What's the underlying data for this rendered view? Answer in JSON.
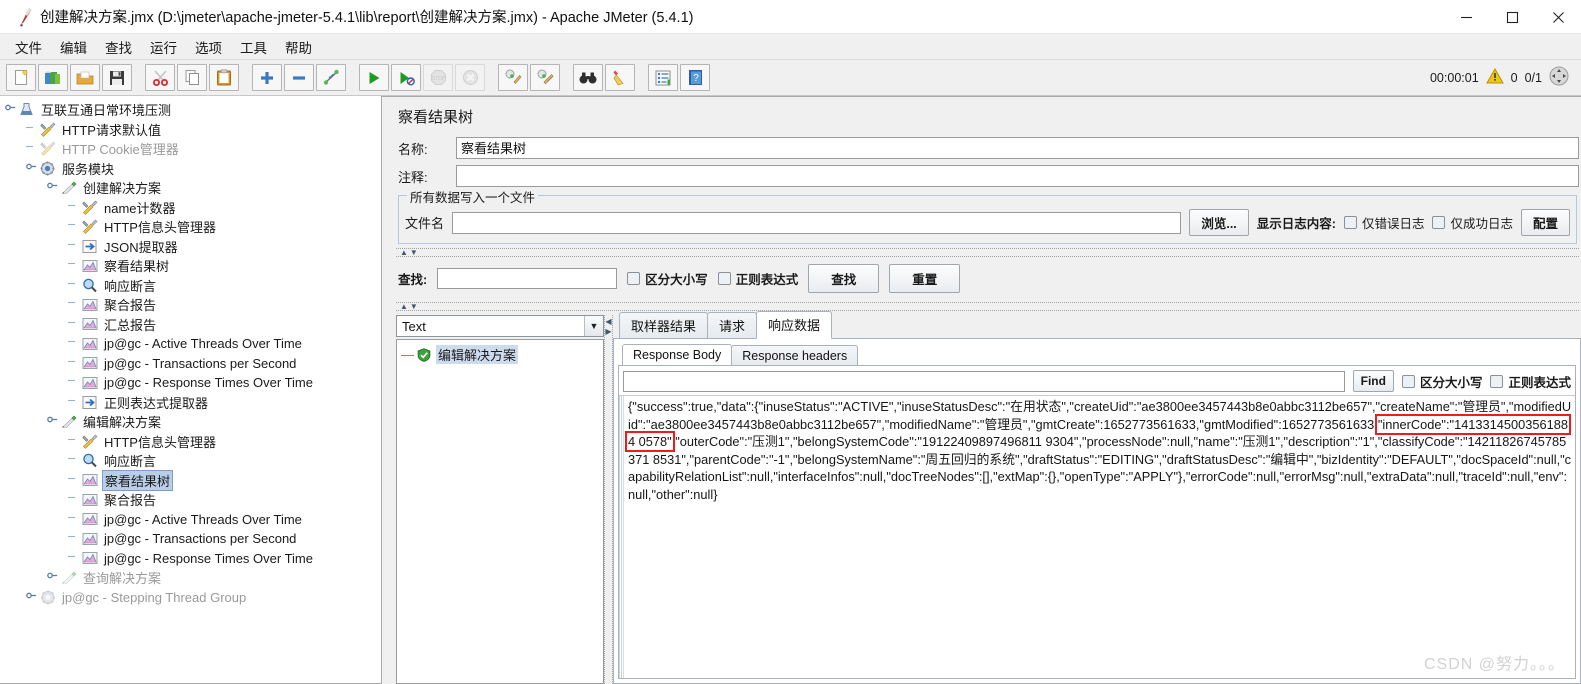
{
  "window": {
    "title": "创建解决方案.jmx (D:\\jmeter\\apache-jmeter-5.4.1\\lib\\report\\创建解决方案.jmx) - Apache JMeter (5.4.1)",
    "icon": "jmeter-feather-icon",
    "minimize": "—",
    "maximize": "☐",
    "close": "✕"
  },
  "menubar": {
    "items": [
      {
        "label": "文件",
        "name": "menu-file"
      },
      {
        "label": "编辑",
        "name": "menu-edit"
      },
      {
        "label": "查找",
        "name": "menu-search"
      },
      {
        "label": "运行",
        "name": "menu-run"
      },
      {
        "label": "选项",
        "name": "menu-options"
      },
      {
        "label": "工具",
        "name": "menu-tools"
      },
      {
        "label": "帮助",
        "name": "menu-help"
      }
    ]
  },
  "toolbar": {
    "buttons": [
      {
        "name": "new-button",
        "icon": "new-document-icon",
        "disabled": false
      },
      {
        "name": "templates-button",
        "icon": "templates-icon",
        "disabled": false
      },
      {
        "name": "open-button",
        "icon": "open-folder-icon",
        "disabled": false
      },
      {
        "name": "save-button",
        "icon": "floppy-save-icon",
        "disabled": false
      },
      {
        "sep": true
      },
      {
        "name": "cut-button",
        "icon": "scissors-icon",
        "disabled": false
      },
      {
        "name": "copy-button",
        "icon": "copy-icon",
        "disabled": false
      },
      {
        "name": "paste-button",
        "icon": "clipboard-paste-icon",
        "disabled": false
      },
      {
        "sep": true
      },
      {
        "name": "expand-all-button",
        "icon": "plus-icon",
        "disabled": false
      },
      {
        "name": "collapse-all-button",
        "icon": "minus-icon",
        "disabled": false
      },
      {
        "name": "toggle-button",
        "icon": "toggle-pins-icon",
        "disabled": false
      },
      {
        "sep": true
      },
      {
        "name": "start-button",
        "icon": "play-green-icon",
        "disabled": false
      },
      {
        "name": "start-no-pauses-button",
        "icon": "play-no-pause-icon",
        "disabled": false
      },
      {
        "name": "stop-button",
        "icon": "stop-sign-icon",
        "disabled": true
      },
      {
        "name": "shutdown-button",
        "icon": "shutdown-x-icon",
        "disabled": true
      },
      {
        "sep": true
      },
      {
        "name": "clear-button",
        "icon": "broom-clear-icon",
        "disabled": false
      },
      {
        "name": "clear-all-button",
        "icon": "broom-clear-all-icon",
        "disabled": false
      },
      {
        "sep": true
      },
      {
        "name": "search-button",
        "icon": "binoculars-icon",
        "disabled": false
      },
      {
        "name": "reset-search-button",
        "icon": "broom-yellow-icon",
        "disabled": false
      },
      {
        "sep": true
      },
      {
        "name": "function-helper-button",
        "icon": "list-toolbox-icon",
        "disabled": false
      },
      {
        "name": "help-button",
        "icon": "help-book-icon",
        "disabled": false
      }
    ],
    "status": {
      "elapsed": "00:00:01",
      "warning_icon": "warning-triangle-icon",
      "warning_count": "0",
      "threads": "0/1",
      "expand_icon": "expand-arrows-icon"
    }
  },
  "tree": {
    "nodes": [
      {
        "label": "互联互通日常环境压测",
        "depth": 0,
        "icon": "test-plan-icon",
        "handle": "expanded",
        "state": "normal",
        "name": "tree-node-test-plan"
      },
      {
        "label": "HTTP请求默认值",
        "depth": 1,
        "icon": "config-wrench-icon",
        "handle": "leaf",
        "state": "normal",
        "name": "tree-node-http-defaults"
      },
      {
        "label": "HTTP Cookie管理器",
        "depth": 1,
        "icon": "config-wrench-icon",
        "handle": "leaf",
        "state": "disabled",
        "name": "tree-node-http-cookie-manager"
      },
      {
        "label": "服务模块",
        "depth": 1,
        "icon": "controller-gear-icon",
        "handle": "expanded",
        "state": "normal",
        "name": "tree-node-service-module"
      },
      {
        "label": "创建解决方案",
        "depth": 2,
        "icon": "sampler-pen-icon",
        "handle": "expanded",
        "state": "normal",
        "name": "tree-node-create-solution"
      },
      {
        "label": "name计数器",
        "depth": 3,
        "icon": "config-wrench-icon",
        "handle": "leaf",
        "state": "normal",
        "name": "tree-node-name-counter"
      },
      {
        "label": "HTTP信息头管理器",
        "depth": 3,
        "icon": "config-wrench-icon",
        "handle": "leaf",
        "state": "normal",
        "name": "tree-node-http-header-manager-1"
      },
      {
        "label": "JSON提取器",
        "depth": 3,
        "icon": "postprocessor-arrow-icon",
        "handle": "leaf",
        "state": "normal",
        "name": "tree-node-json-extractor"
      },
      {
        "label": "察看结果树",
        "depth": 3,
        "icon": "listener-chart-icon",
        "handle": "leaf",
        "state": "normal",
        "name": "tree-node-view-results-tree-1"
      },
      {
        "label": "响应断言",
        "depth": 3,
        "icon": "assertion-magnifier-icon",
        "handle": "leaf",
        "state": "normal",
        "name": "tree-node-response-assertion-1"
      },
      {
        "label": "聚合报告",
        "depth": 3,
        "icon": "listener-chart-icon",
        "handle": "leaf",
        "state": "normal",
        "name": "tree-node-aggregate-report-1"
      },
      {
        "label": "汇总报告",
        "depth": 3,
        "icon": "listener-chart-icon",
        "handle": "leaf",
        "state": "normal",
        "name": "tree-node-summary-report"
      },
      {
        "label": "jp@gc - Active Threads Over Time",
        "depth": 3,
        "icon": "listener-chart-icon",
        "handle": "leaf",
        "state": "normal",
        "name": "tree-node-active-threads-1"
      },
      {
        "label": "jp@gc - Transactions per Second",
        "depth": 3,
        "icon": "listener-chart-icon",
        "handle": "leaf",
        "state": "normal",
        "name": "tree-node-tps-1"
      },
      {
        "label": "jp@gc - Response Times Over Time",
        "depth": 3,
        "icon": "listener-chart-icon",
        "handle": "leaf",
        "state": "normal",
        "name": "tree-node-response-times-1"
      },
      {
        "label": "正则表达式提取器",
        "depth": 3,
        "icon": "postprocessor-arrow-icon",
        "handle": "leaf",
        "state": "normal",
        "name": "tree-node-regex-extractor"
      },
      {
        "label": "编辑解决方案",
        "depth": 2,
        "icon": "sampler-pen-icon",
        "handle": "expanded",
        "state": "normal",
        "name": "tree-node-edit-solution"
      },
      {
        "label": "HTTP信息头管理器",
        "depth": 3,
        "icon": "config-wrench-icon",
        "handle": "leaf",
        "state": "normal",
        "name": "tree-node-http-header-manager-2"
      },
      {
        "label": "响应断言",
        "depth": 3,
        "icon": "assertion-magnifier-icon",
        "handle": "leaf",
        "state": "normal",
        "name": "tree-node-response-assertion-2"
      },
      {
        "label": "察看结果树",
        "depth": 3,
        "icon": "listener-chart-icon",
        "handle": "leaf",
        "state": "selected",
        "name": "tree-node-view-results-tree-2"
      },
      {
        "label": "聚合报告",
        "depth": 3,
        "icon": "listener-chart-icon",
        "handle": "leaf",
        "state": "normal",
        "name": "tree-node-aggregate-report-2"
      },
      {
        "label": "jp@gc - Active Threads Over Time",
        "depth": 3,
        "icon": "listener-chart-icon",
        "handle": "leaf",
        "state": "normal",
        "name": "tree-node-active-threads-2"
      },
      {
        "label": "jp@gc - Transactions per Second",
        "depth": 3,
        "icon": "listener-chart-icon",
        "handle": "leaf",
        "state": "normal",
        "name": "tree-node-tps-2"
      },
      {
        "label": "jp@gc - Response Times Over Time",
        "depth": 3,
        "icon": "listener-chart-icon",
        "handle": "leaf",
        "state": "normal",
        "name": "tree-node-response-times-2"
      },
      {
        "label": "查询解决方案",
        "depth": 2,
        "icon": "sampler-pen-icon",
        "handle": "collapsed",
        "state": "disabled",
        "name": "tree-node-query-solution"
      },
      {
        "label": "jp@gc - Stepping Thread Group",
        "depth": 1,
        "icon": "thread-group-gear-icon",
        "handle": "collapsed",
        "state": "disabled",
        "name": "tree-node-stepping-thread-group"
      }
    ]
  },
  "panel": {
    "title": "察看结果树",
    "name_label": "名称:",
    "name_value": "察看结果树",
    "comment_label": "注释:",
    "comment_value": "",
    "filegroup_title": "所有数据写入一个文件",
    "filename_label": "文件名",
    "filename_value": "",
    "browse_button": "浏览...",
    "log_display_label": "显示日志内容:",
    "errors_only": "仅错误日志",
    "success_only": "仅成功日志",
    "configure_button": "配置"
  },
  "search": {
    "label": "查找:",
    "value": "",
    "case_sensitive": "区分大小写",
    "regex": "正则表达式",
    "find_button": "查找",
    "reset_button": "重置"
  },
  "results": {
    "render_combo": "Text",
    "render_arrow_icon": "chevron-down-icon",
    "sample_tree": [
      {
        "label": "编辑解决方案",
        "icon": "success-shield-icon",
        "selected": true
      }
    ],
    "tabs": [
      {
        "label": "取样器结果",
        "active": false,
        "name": "tab-sampler-result"
      },
      {
        "label": "请求",
        "active": false,
        "name": "tab-request"
      },
      {
        "label": "响应数据",
        "active": true,
        "name": "tab-response-data"
      }
    ],
    "subtabs": [
      {
        "label": "Response Body",
        "active": true,
        "name": "subtab-response-body"
      },
      {
        "label": "Response headers",
        "active": false,
        "name": "subtab-response-headers"
      }
    ],
    "find": {
      "value": "",
      "button": "Find",
      "case_sensitive": "区分大小写",
      "regex": "正则表达式"
    },
    "response_body": "{\"success\":true,\"data\":{\"inuseStatus\":\"ACTIVE\",\"inuseStatusDesc\":\"在用状态\",\"createUid\":\"ae3800ee3457443b8e0abbc3112be657\",\"createName\":\"管理员\",\"modifiedUid\":\"ae3800ee3457443b8e0abbc3112be657\",\"modifiedName\":\"管理员\",\"gmtCreate\":1652773561633,\"gmtModified\":1652773561633,\"innerCode\":\"14133145003561884 0578\",\"outerCode\":\"压测1\",\"belongSystemCode\":\"19122409897496811 9304\",\"processNode\":null,\"name\":\"压测1\",\"description\":\"1\",\"classifyCode\":\"14211826745785371 8531\",\"parentCode\":\"-1\",\"belongSystemName\":\"周五回归的系统\",\"draftStatus\":\"EDITING\",\"draftStatusDesc\":\"编辑中\",\"bizIdentity\":\"DEFAULT\",\"docSpaceId\":null,\"capabilityRelationList\":null,\"interfaceInfos\":null,\"docTreeNodes\":[],\"extMap\":{},\"openType\":\"APPLY\"},\"errorCode\":null,\"errorMsg\":null,\"extraData\":null,\"traceId\":null,\"env\":null,\"other\":null}",
    "highlight_text": "\"innerCode\":\"14133145003561884 0578\"",
    "highlight_color": "#ee1c1c"
  },
  "watermark": "CSDN @努力。。。"
}
